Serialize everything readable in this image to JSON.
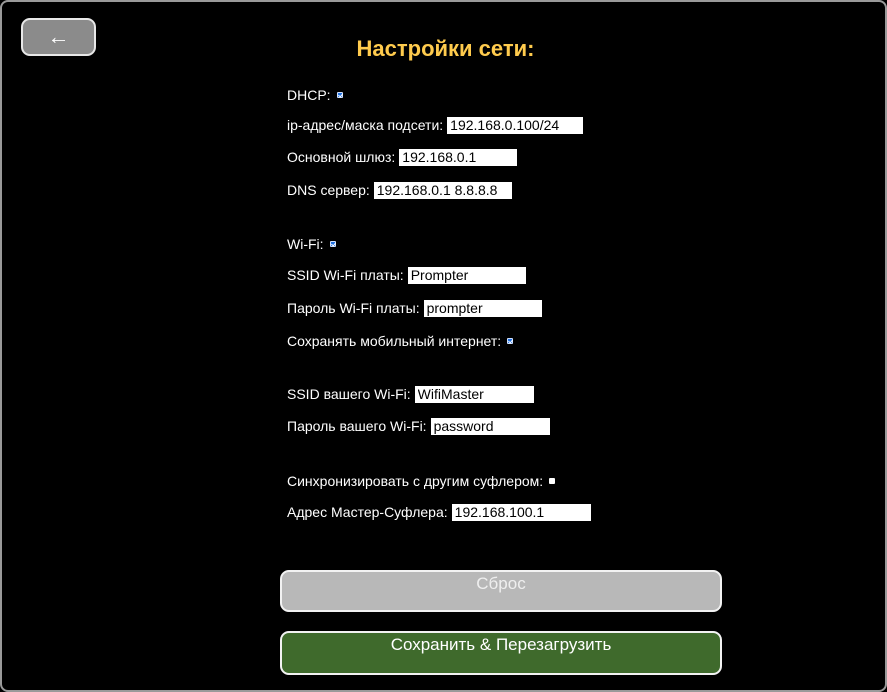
{
  "header": {
    "back_label": "←",
    "title": "Настройки сети:"
  },
  "network": {
    "dhcp_label": "DHCP:",
    "dhcp_checked": true,
    "ip_label": "ip-адрес/маска подсети:",
    "ip_value": "192.168.0.100/24",
    "gateway_label": "Основной шлюз:",
    "gateway_value": "192.168.0.1",
    "dns_label": "DNS сервер:",
    "dns_value": "192.168.0.1 8.8.8.8"
  },
  "wifi": {
    "wifi_label": "Wi-Fi:",
    "wifi_checked": true,
    "board_ssid_label": "SSID Wi-Fi платы:",
    "board_ssid_value": "Prompter",
    "board_password_label": "Пароль Wi-Fi платы:",
    "board_password_value": "prompter",
    "keep_mobile_label": "Сохранять мобильный интернет:",
    "keep_mobile_checked": true,
    "your_ssid_label": "SSID вашего Wi-Fi:",
    "your_ssid_value": "WifiMaster",
    "your_password_label": "Пароль вашего Wi-Fi:",
    "your_password_value": "password"
  },
  "sync": {
    "sync_label": "Синхронизировать с другим суфлером:",
    "sync_checked": false,
    "master_label": "Адрес Мастер-Суфлера:",
    "master_value": "192.168.100.1"
  },
  "actions": {
    "reset_label": "Сброс",
    "save_label": "Сохранить & Перезагрузить"
  }
}
